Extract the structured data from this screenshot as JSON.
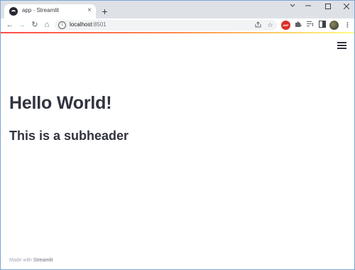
{
  "browser": {
    "tab": {
      "title": "app · Streamlit",
      "close": "×"
    },
    "new_tab": "+",
    "window_controls": {
      "minimize": "−",
      "maximize": "□",
      "close": "×",
      "dropdown": "⌄"
    },
    "nav": {
      "back": "←",
      "forward": "→",
      "reload": "↻",
      "home": "⌂"
    },
    "address": {
      "host": "localhost",
      "port": ":8501"
    },
    "icons": {
      "share": "share-icon",
      "bookmark": "star-icon",
      "adblock": "adblock-extension-icon",
      "extensions": "puzzle-icon",
      "reading_list": "reading-list-icon",
      "side_panel": "side-panel-icon",
      "profile": "profile-avatar",
      "menu": "kebab-menu-icon"
    },
    "adblock_label": "ABP",
    "accent_colors": [
      "#ff4b4b",
      "#fffd80"
    ]
  },
  "app": {
    "title": "Hello World!",
    "subheader": "This is a subheader",
    "footer_prefix": "Made with ",
    "footer_link": "Streamlit"
  }
}
